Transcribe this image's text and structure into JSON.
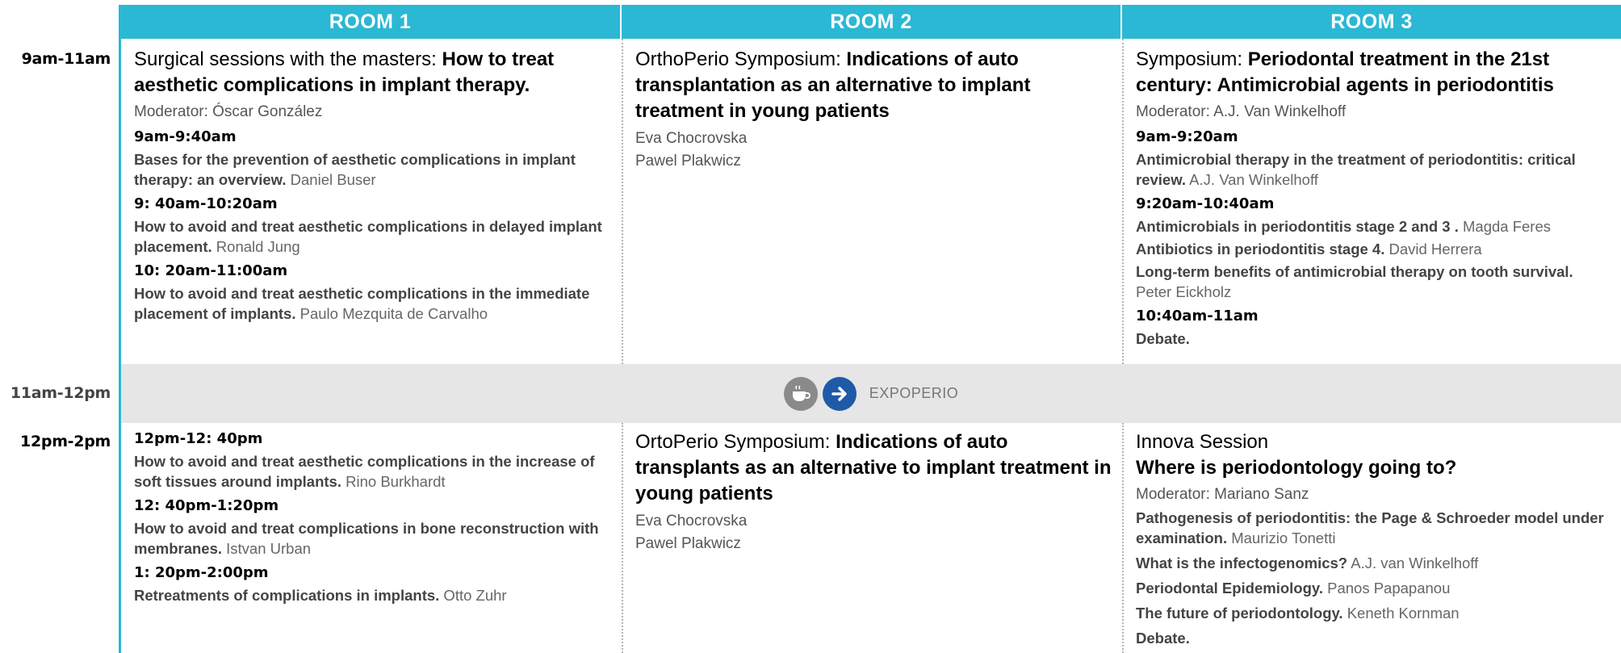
{
  "rooms": [
    "ROOM 1",
    "ROOM 2",
    "ROOM 3"
  ],
  "times": {
    "slot1": "9am-11am",
    "break": "11am-12pm",
    "slot2": "12pm-2pm"
  },
  "break_label": "EXPOPERIO",
  "icons": [
    "coffee-cup-icon",
    "arrow-right-icon"
  ],
  "colors": {
    "header": "#2bb8d4",
    "arrow_circle": "#1f5aa8",
    "break_band": "#e6e6e6"
  },
  "r1s1": {
    "title_pre": "Surgical sessions with the masters: ",
    "title_bold": "How to treat aesthetic complications in implant therapy.",
    "moderator": "Moderator: Óscar González",
    "talks": [
      {
        "time": "9am-9:40am",
        "title": "Bases for the prevention of aesthetic complications in implant therapy: an overview.",
        "speaker": " Daniel Buser"
      },
      {
        "time": "9: 40am-10:20am",
        "title": "How to avoid and treat aesthetic complications in delayed implant placement.",
        "speaker": " Ronald Jung"
      },
      {
        "time": "10: 20am-11:00am",
        "title": "How to avoid and treat aesthetic complications in the immediate placement of implants.",
        "speaker": " Paulo Mezquita de Carvalho"
      }
    ]
  },
  "r2s1": {
    "title_pre": "OrthoPerio Symposium: ",
    "title_bold": "Indications of auto transplantation as an alternative to implant treatment in young patients",
    "speakers": [
      "Eva Chocrovska",
      "Pawel Plakwicz"
    ]
  },
  "r3s1": {
    "title_pre": "Symposium: ",
    "title_bold": "Periodontal treatment in the 21st century: Antimicrobial agents in periodontitis",
    "moderator": "Moderator: A.J. Van Winkelhoff",
    "t1": "9am-9:20am",
    "talk1": {
      "title": "Antimicrobial therapy in the treatment of periodontitis: critical review.",
      "speaker": " A.J. Van Winkelhoff"
    },
    "t2": "9:20am-10:40am",
    "talk2": {
      "title": "Antimicrobials in periodontitis stage 2 and 3 .",
      "speaker": " Magda Feres"
    },
    "talk3": {
      "title": "Antibiotics in periodontitis stage 4.",
      "speaker": " David Herrera"
    },
    "talk4": {
      "title": "Long-term benefits of antimicrobial therapy on tooth survival.",
      "speaker": " Peter Eickholz"
    },
    "t3": "10:40am-11am",
    "debate": "Debate."
  },
  "r1s2": {
    "talks": [
      {
        "time": "12pm-12: 40pm",
        "title": "How to avoid and treat aesthetic complications in the increase of soft tissues around implants.",
        "speaker": " Rino Burkhardt"
      },
      {
        "time": "12: 40pm-1:20pm",
        "title": "How to avoid and treat complications in bone reconstruction with membranes.",
        "speaker": " Istvan Urban"
      },
      {
        "time": "1: 20pm-2:00pm",
        "title": "Retreatments of complications in implants.",
        "speaker": " Otto Zuhr"
      }
    ]
  },
  "r2s2": {
    "title_pre": "OrtoPerio Symposium: ",
    "title_bold": "Indications of auto transplants as an alternative to implant treatment in young patients",
    "speakers": [
      "Eva Chocrovska",
      "Pawel Plakwicz"
    ]
  },
  "r3s2": {
    "title_pre": "Innova Session",
    "title_bold": "Where is periodontology going to?",
    "moderator": "Moderator: Mariano Sanz",
    "talks": [
      {
        "title": "Pathogenesis of periodontitis: the Page & Schroeder model under examination.",
        "speaker": " Maurizio Tonetti"
      },
      {
        "title": "What is the infectogenomics?",
        "speaker": " A.J. van Winkelhoff"
      },
      {
        "title": "Periodontal Epidemiology.",
        "speaker": " Panos Papapanou"
      },
      {
        "title": "The future of periodontology.",
        "speaker": " Keneth Kornman"
      }
    ],
    "debate": "Debate."
  }
}
